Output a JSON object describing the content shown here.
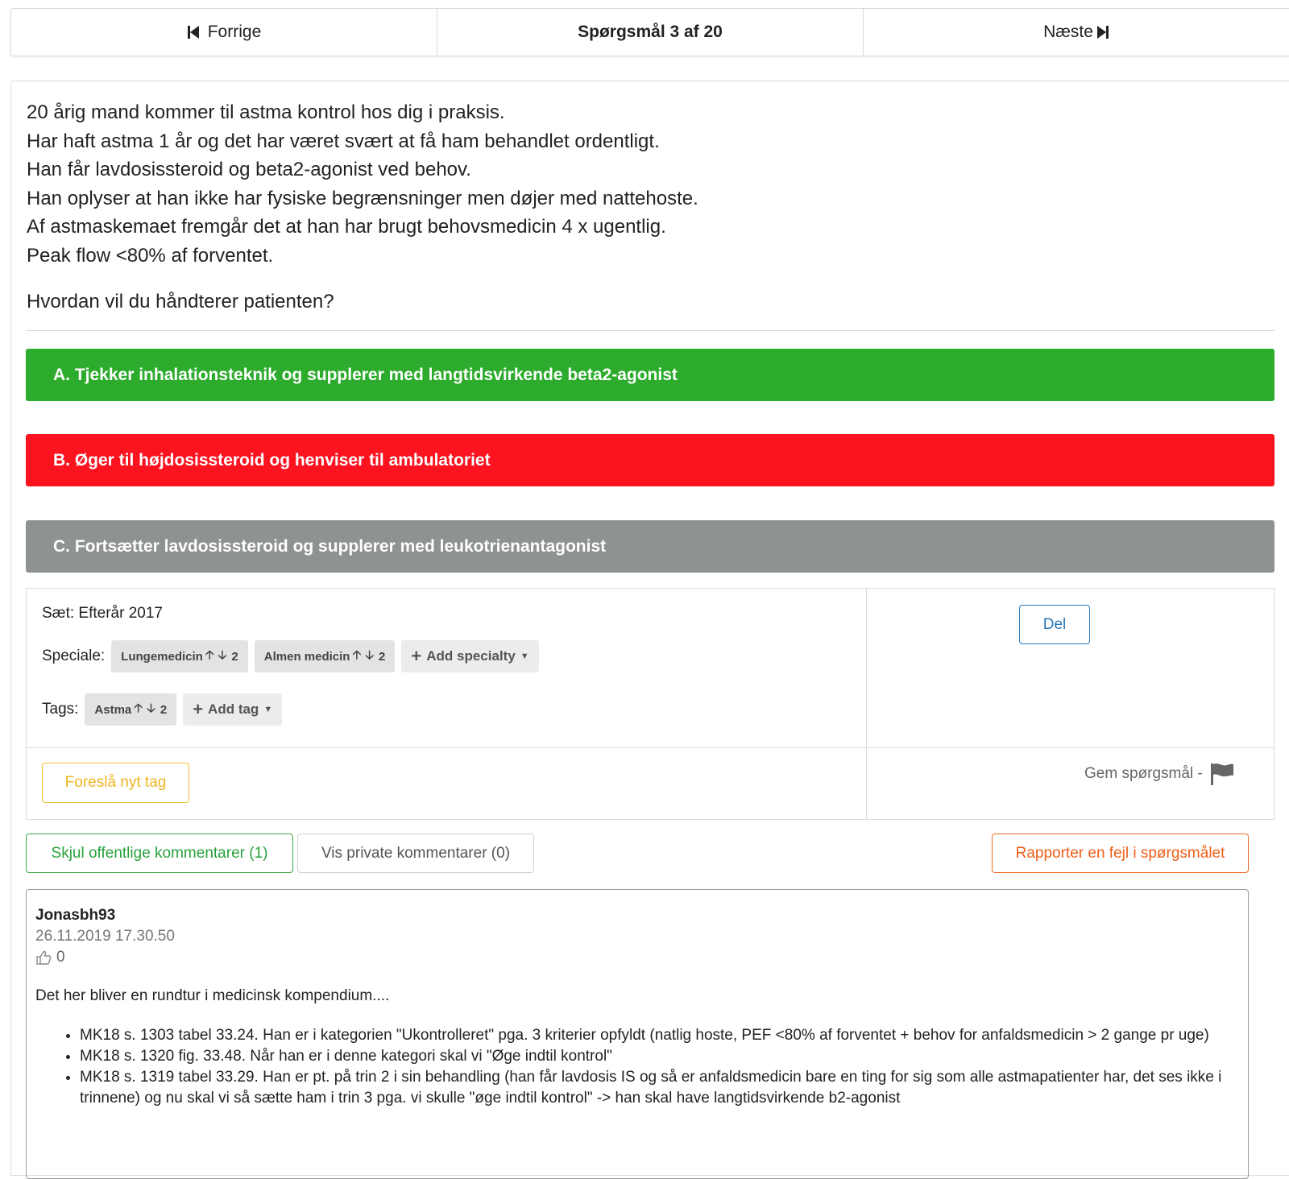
{
  "nav": {
    "prev_label": "Forrige",
    "position_label": "Spørgsmål 3 af 20",
    "next_label": "Næste"
  },
  "question": {
    "lines": [
      "20 årig mand kommer til astma kontrol hos dig i praksis.",
      "Har haft astma 1 år og det har været svært at få ham behandlet ordentligt.",
      "Han får lavdosissteroid og beta2-agonist ved behov.",
      "Han oplyser at han ikke har fysiske begrænsninger men døjer med nattehoste.",
      "Af astmaskemaet fremgår det at han har brugt behovsmedicin 4 x ugentlig.",
      "Peak flow <80% af forventet."
    ],
    "prompt": "Hvordan vil du håndterer patienten?"
  },
  "answers": [
    {
      "label": "A. Tjekker inhalationsteknik og supplerer med langtidsvirkende beta2-agonist",
      "status": "correct",
      "color": "#2cab2c"
    },
    {
      "label": "B. Øger til højdosissteroid og henviser til ambulatoriet",
      "status": "wrong",
      "color": "#fb1320"
    },
    {
      "label": "C. Fortsætter lavdosissteroid og supplerer med leukotrienantagonist",
      "status": "neutral",
      "color": "#8f9390"
    }
  ],
  "meta": {
    "set_label": "Sæt: Efterår 2017",
    "specialty_label": "Speciale:",
    "specialties": [
      {
        "name": "Lungemedicin",
        "votes": "2"
      },
      {
        "name": "Almen medicin",
        "votes": "2"
      }
    ],
    "add_specialty_label": "Add specialty",
    "tags_label": "Tags:",
    "tags": [
      {
        "name": "Astma",
        "votes": "2"
      }
    ],
    "add_tag_label": "Add tag",
    "share_label": "Del",
    "suggest_tag_label": "Foreslå nyt tag",
    "save_label": "Gem spørgsmål -"
  },
  "comment_controls": {
    "public_label": "Skjul offentlige kommentarer (1)",
    "private_label": "Vis private kommentarer (0)",
    "report_label": "Rapporter en fejl i spørgsmålet"
  },
  "comment": {
    "author": "Jonasbh93",
    "date": "26.11.2019 17.30.50",
    "likes": "0",
    "body": "Det her bliver en rundtur i medicinsk kompendium....",
    "bullets": [
      "MK18 s. 1303 tabel 33.24. Han er i kategorien \"Ukontrolleret\" pga. 3 kriterier opfyldt (natlig hoste, PEF <80% af forventet + behov for anfaldsmedicin > 2 gange pr uge)",
      "MK18 s. 1320 fig. 33.48. Når han er i denne kategori skal vi \"Øge indtil kontrol\"",
      "MK18 s. 1319 tabel 33.29. Han er pt. på trin 2 i sin behandling (han får lavdosis IS og så er anfaldsmedicin bare en ting for sig som alle astmapatienter har, det ses ikke i trinnene) og nu skal vi så sætte ham i trin 3 pga. vi skulle \"øge indtil kontrol\" -> han skal have langtidsvirkende b2-agonist"
    ]
  },
  "colors": {
    "correct": "#2cab2c",
    "wrong": "#fb1320",
    "neutral": "#8f9390",
    "share_blue": "#2a79b8",
    "suggest_yellow": "#f0c030",
    "report_orange": "#f06a22",
    "public_green": "#37a845"
  },
  "icons": [
    "skip-back-icon",
    "skip-forward-icon",
    "flag-icon",
    "thumbs-up-icon",
    "plus-icon",
    "caret-down-icon",
    "arrow-up-icon",
    "arrow-down-icon"
  ]
}
